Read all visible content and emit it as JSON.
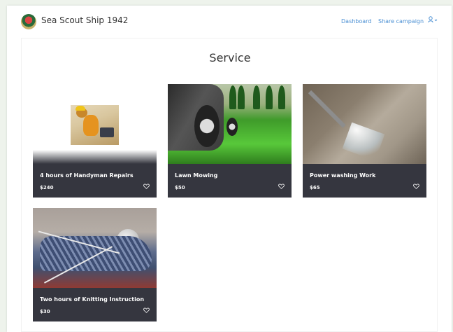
{
  "header": {
    "brand": "Sea Scout Ship 1942",
    "nav": {
      "dashboard": "Dashboard",
      "share": "Share campaign"
    },
    "user_icon": "user-icon"
  },
  "page": {
    "title": "Service"
  },
  "cards": [
    {
      "title": "4 hours of Handyman Repairs",
      "price": "$240",
      "image": "handyman-dog-image"
    },
    {
      "title": "Lawn Mowing",
      "price": "$50",
      "image": "lawn-mower-image"
    },
    {
      "title": "Power washing Work",
      "price": "$65",
      "image": "power-washer-image"
    },
    {
      "title": "Two hours of Knitting Instruction",
      "price": "$30",
      "image": "knitting-image"
    }
  ],
  "colors": {
    "accent": "#4a8fd3",
    "card_footer": "#35363f",
    "background": "#eef3ec"
  }
}
